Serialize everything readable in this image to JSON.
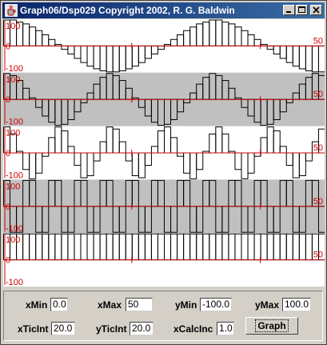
{
  "window": {
    "title": "Graph06/Dsp029 Copyright 2002, R. G. Baldwin"
  },
  "colors": {
    "axis": "#cc0000",
    "bar": "#000000",
    "plot_white": "#ffffff",
    "plot_gray": "#c0c0c0",
    "titlebar": "#0a246a"
  },
  "chart_data": [
    {
      "type": "bar",
      "id": "plot-1",
      "waveform": "cosine, period 50 samples",
      "x_range": [
        0,
        50
      ],
      "y_range": [
        -100,
        100
      ],
      "tick_labels": {
        "ymax": "100",
        "ymin": "-100",
        "origin": "0",
        "xmax": "50"
      },
      "background": "white",
      "values": [
        100,
        100,
        92,
        85,
        73,
        59,
        43,
        25,
        6,
        -13,
        -31,
        -48,
        -64,
        -78,
        -88,
        -96,
        -100,
        -100,
        -96,
        -88,
        -78,
        -64,
        -48,
        -31,
        -13,
        6,
        25,
        43,
        59,
        73,
        85,
        92,
        100,
        100,
        92,
        85,
        73,
        59,
        43,
        25,
        6,
        -13,
        -31,
        -48,
        -64,
        -78,
        -88,
        -96,
        -100,
        -100
      ]
    },
    {
      "type": "bar",
      "id": "plot-2",
      "waveform": "cosine, period 25 samples",
      "x_range": [
        0,
        50
      ],
      "y_range": [
        -100,
        100
      ],
      "tick_labels": {
        "ymax": "100",
        "ymin": "-100",
        "origin": "0",
        "xmax": "50"
      },
      "background": "gray",
      "values": [
        100,
        92,
        73,
        43,
        6,
        -31,
        -64,
        -88,
        -100,
        -96,
        -78,
        -48,
        -13,
        25,
        59,
        85,
        100,
        92,
        73,
        43,
        6,
        -31,
        -64,
        -88,
        -100,
        -96,
        -78,
        -48,
        -13,
        25,
        59,
        85,
        100,
        92,
        73,
        43,
        6,
        -31,
        -64,
        -88,
        -100,
        -96,
        -78,
        -48,
        -13,
        25,
        59,
        85,
        100,
        92
      ]
    },
    {
      "type": "bar",
      "id": "plot-3",
      "waveform": "cosine, period 12.5 samples",
      "x_range": [
        0,
        50
      ],
      "y_range": [
        -100,
        100
      ],
      "tick_labels": {
        "ymax": "100",
        "ymin": "-100",
        "origin": "0",
        "xmax": "50"
      },
      "background": "white",
      "values": [
        100,
        73,
        6,
        -64,
        -100,
        -78,
        -13,
        59,
        100,
        85,
        25,
        -48,
        -96,
        -88,
        -31,
        43,
        100,
        92,
        43,
        -31,
        -88,
        -96,
        -48,
        25,
        85,
        100,
        59,
        -13,
        -78,
        -100,
        -64,
        6,
        73,
        100,
        73,
        6,
        -64,
        -100,
        -78,
        -13,
        59,
        100,
        85,
        25,
        -48,
        -96,
        -88,
        -31,
        43,
        92
      ]
    },
    {
      "type": "bar",
      "id": "plot-4",
      "waveform": "alternating square pulses",
      "x_range": [
        0,
        50
      ],
      "y_range": [
        -100,
        100
      ],
      "tick_labels": {
        "ymax": "100",
        "ymin": "-100",
        "origin": "0",
        "xmax": "50"
      },
      "background": "gray",
      "values": [
        100,
        -100,
        -100,
        100,
        100,
        -100,
        -100,
        100,
        100,
        -100,
        -100,
        100,
        100,
        -100,
        -100,
        100,
        100,
        -100,
        -100,
        100,
        100,
        -100,
        -100,
        100,
        100,
        -100,
        -100,
        100,
        100,
        -100,
        -100,
        100,
        100,
        -100,
        -100,
        100,
        100,
        -100,
        -100,
        100,
        100,
        -100,
        -100,
        100,
        100,
        -100,
        -100,
        100,
        100,
        -100
      ]
    },
    {
      "type": "bar",
      "id": "plot-5",
      "waveform": "constant positive",
      "x_range": [
        0,
        50
      ],
      "y_range": [
        -100,
        100
      ],
      "tick_labels": {
        "ymax": "100",
        "ymin": "-100",
        "origin": "0",
        "xmax": "50"
      },
      "background": "white",
      "values": [
        100,
        100,
        100,
        100,
        100,
        100,
        100,
        100,
        100,
        100,
        100,
        100,
        100,
        100,
        100,
        100,
        100,
        100,
        100,
        100,
        100,
        100,
        100,
        100,
        100,
        100,
        100,
        100,
        100,
        100,
        100,
        100,
        100,
        100,
        100,
        100,
        100,
        100,
        100,
        100,
        100,
        100,
        100,
        100,
        100,
        100,
        100,
        100,
        100,
        100
      ]
    }
  ],
  "controls": {
    "xmin": {
      "label": "xMin",
      "value": "0.0"
    },
    "xmax": {
      "label": "xMax",
      "value": "50"
    },
    "ymin": {
      "label": "yMin",
      "value": "-100.0"
    },
    "ymax": {
      "label": "yMax",
      "value": "100.0"
    },
    "xticint": {
      "label": "xTicInt",
      "value": "20.0"
    },
    "yticint": {
      "label": "yTicInt",
      "value": "20.0"
    },
    "xcalcinc": {
      "label": "xCalcInc",
      "value": "1.0"
    },
    "graph_button": "Graph"
  }
}
